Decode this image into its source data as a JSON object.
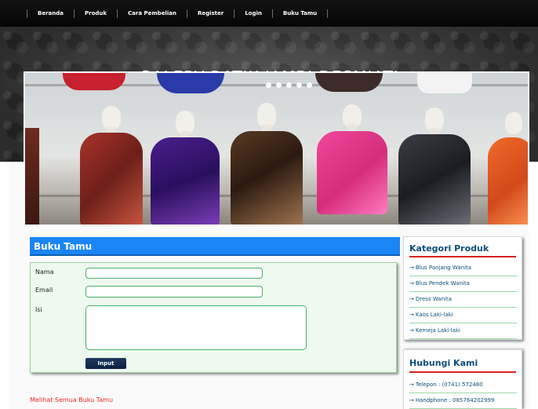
{
  "nav": {
    "items": [
      "Beranda",
      "Produk",
      "Cara Pembelian",
      "Register",
      "Login",
      "Buku Tamu"
    ]
  },
  "header": {
    "site_title": "GALERY BATIK JAMBI DESMIATI"
  },
  "guestbook": {
    "title": "Buku Tamu",
    "labels": {
      "name": "Nama",
      "email": "Email",
      "message": "Isi"
    },
    "values": {
      "name": "",
      "email": "",
      "message": ""
    },
    "submit_label": "Input",
    "see_all_link": "Melihat Semua Buku Tamu"
  },
  "sidebar": {
    "categories": {
      "title": "Kategori Produk",
      "items": [
        "Blus Panjang Wanita",
        "Blus Pendek Wanita",
        "Dress Wanita",
        "Kaos Laki-laki",
        "Kemeja Laki-laki"
      ]
    },
    "contact": {
      "title": "Hubungi Kami",
      "items": [
        "Telepon : (0741) 572480",
        "Handphone : 085764202999"
      ]
    }
  },
  "colors": {
    "accent_blue": "#1a86f5",
    "link_red": "#ee2b2b",
    "sidebar_text": "#0a4e7b",
    "form_background": "#eefaef"
  },
  "icons": {
    "list_bullet": "arrow-right-icon"
  }
}
